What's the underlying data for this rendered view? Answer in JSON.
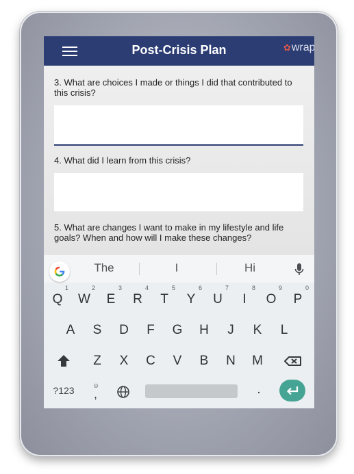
{
  "app_bar": {
    "title": "Post-Crisis Plan",
    "logo_text": "wrap.",
    "bg_color": "#2b3d73"
  },
  "form": {
    "questions": [
      {
        "label": "3. What are choices I made or things I did that contributed to this crisis?",
        "value": ""
      },
      {
        "label": "4. What did I learn from this crisis?",
        "value": ""
      },
      {
        "label": "5. What are changes I want to make in my lifestyle and life goals? When and how will I make these changes?"
      }
    ]
  },
  "keyboard": {
    "suggestions": [
      "The",
      "I",
      "Hi"
    ],
    "row1": [
      {
        "key": "Q",
        "hint": "1"
      },
      {
        "key": "W",
        "hint": "2"
      },
      {
        "key": "E",
        "hint": "3"
      },
      {
        "key": "R",
        "hint": "4"
      },
      {
        "key": "T",
        "hint": "5"
      },
      {
        "key": "Y",
        "hint": "6"
      },
      {
        "key": "U",
        "hint": "7"
      },
      {
        "key": "I",
        "hint": "8"
      },
      {
        "key": "O",
        "hint": "9"
      },
      {
        "key": "P",
        "hint": "0"
      }
    ],
    "row2": [
      "A",
      "S",
      "D",
      "F",
      "G",
      "H",
      "J",
      "K",
      "L"
    ],
    "row3": [
      "Z",
      "X",
      "C",
      "V",
      "B",
      "N",
      "M"
    ],
    "symbols_label": "?123",
    "comma_label": ",",
    "period_label": ".",
    "icons": [
      "google-g-icon",
      "microphone-icon",
      "shift-icon",
      "backspace-icon",
      "emoji-icon",
      "globe-icon",
      "enter-arrow-icon"
    ],
    "enter_color": "#46a495"
  }
}
